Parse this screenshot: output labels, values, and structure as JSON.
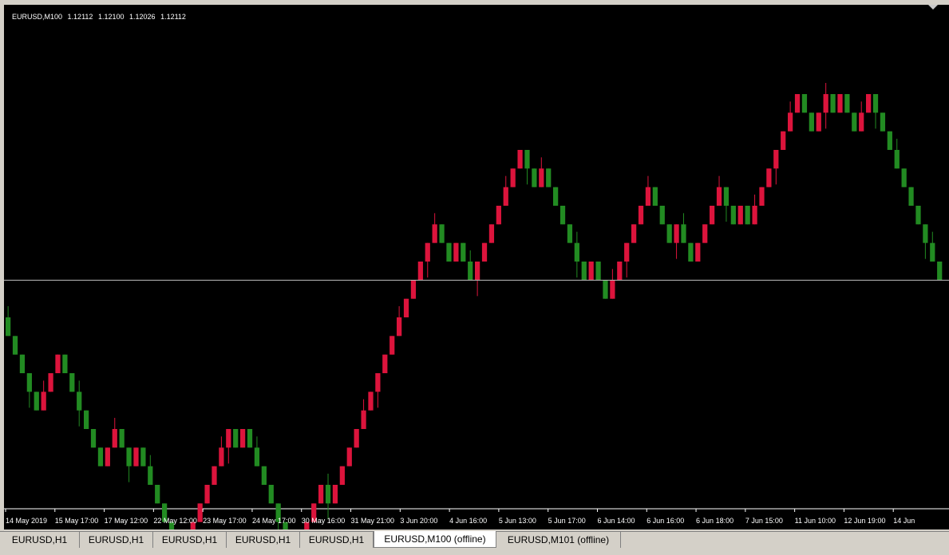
{
  "window": {
    "symbol_header": {
      "symbol": "EURUSD,M100",
      "open": "1.12112",
      "high": "1.12100",
      "low": "1.12026",
      "close": "1.12112"
    }
  },
  "tabs": [
    {
      "label": "EURUSD,H1",
      "active": false
    },
    {
      "label": "EURUSD,H1",
      "active": false
    },
    {
      "label": "EURUSD,H1",
      "active": false
    },
    {
      "label": "EURUSD,H1",
      "active": false
    },
    {
      "label": "EURUSD,H1",
      "active": false
    },
    {
      "label": "EURUSD,M100 (offline)",
      "active": true
    },
    {
      "label": "EURUSD,M101 (offline)",
      "active": false
    }
  ],
  "colors": {
    "background": "#000000",
    "bull": "#228B22",
    "bear": "#DC143C",
    "bid_line": "#c0c0c0",
    "axis_text": "#ffffff"
  },
  "chart_data": {
    "type": "candlestick",
    "symbol": "EURUSD",
    "timeframe": "M100",
    "brick_size": 0.001,
    "y_range": [
      1.109,
      1.136
    ],
    "bid_line": 1.1212,
    "x_tick_labels": [
      "14 May 2019",
      "15 May 17:00",
      "17 May 12:00",
      "22 May 12:00",
      "23 May 17:00",
      "24 May 17:00",
      "30 May 16:00",
      "31 May 21:00",
      "3 Jun 20:00",
      "4 Jun 16:00",
      "5 Jun 13:00",
      "5 Jun 17:00",
      "6 Jun 14:00",
      "6 Jun 16:00",
      "6 Jun 18:00",
      "7 Jun 15:00",
      "11 Jun 10:00",
      "12 Jun 19:00",
      "14 Jun"
    ],
    "moves": [
      -1,
      -1,
      -1,
      -1,
      -1,
      1,
      1,
      1,
      -1,
      -1,
      -1,
      -1,
      -1,
      -1,
      1,
      1,
      -1,
      -1,
      1,
      -1,
      -1,
      -1,
      -1,
      -1,
      -1,
      1,
      1,
      1,
      1,
      1,
      1,
      1,
      -1,
      1,
      -1,
      -1,
      -1,
      -1,
      -1,
      -1,
      -1,
      1,
      1,
      1,
      1,
      -1,
      1,
      1,
      1,
      1,
      1,
      1,
      1,
      1,
      1,
      1,
      1,
      1,
      1,
      1,
      1,
      -1,
      -1,
      1,
      -1,
      -1,
      1,
      1,
      1,
      1,
      1,
      1,
      1,
      -1,
      -1,
      1,
      -1,
      -1,
      -1,
      -1,
      -1,
      -1,
      1,
      -1,
      -1,
      1,
      1,
      1,
      1,
      1,
      1,
      -1,
      -1,
      -1,
      1,
      -1,
      -1,
      1,
      1,
      1,
      1,
      -1,
      -1,
      1,
      -1,
      1,
      1,
      1,
      1,
      1,
      1,
      1,
      -1,
      -1,
      1,
      1,
      -1,
      1,
      -1,
      -1,
      1,
      1,
      -1,
      -1,
      -1,
      -1,
      -1,
      -1,
      -1,
      -1,
      -1,
      -1
    ]
  }
}
